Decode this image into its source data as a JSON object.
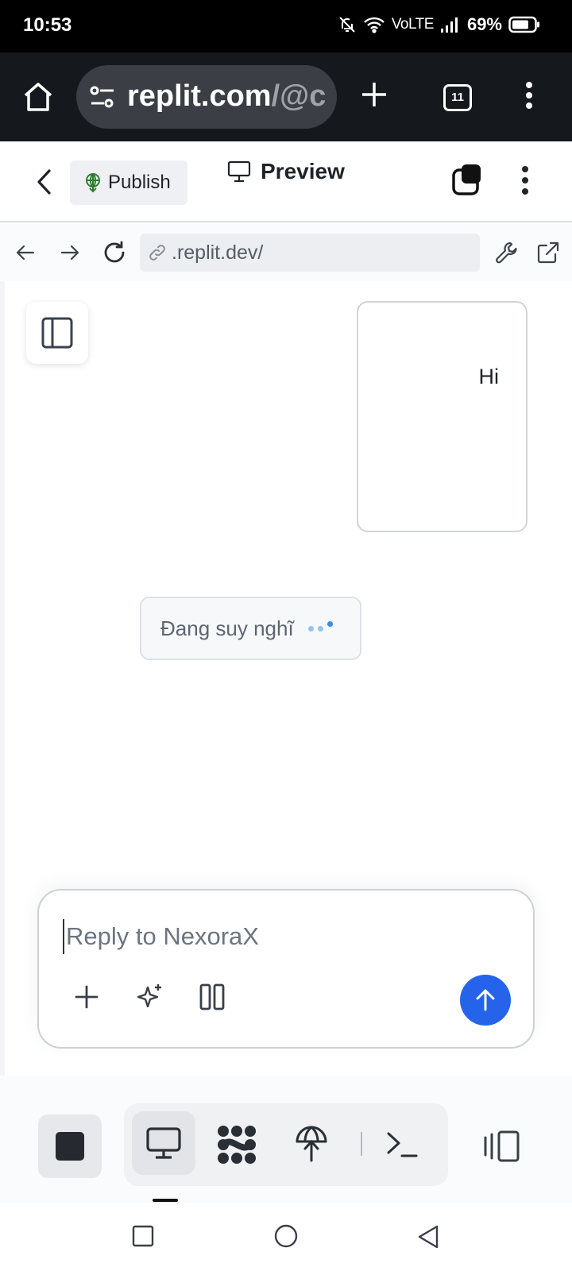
{
  "status_bar": {
    "time": "10:53",
    "network": "VoLTE",
    "battery": "69%"
  },
  "browser": {
    "url_main": "replit.com",
    "url_tail": "/@c",
    "tab_count": "11"
  },
  "topbar": {
    "publish_label": "Publish",
    "preview_label": "Preview"
  },
  "preview_nav": {
    "address": ".replit.dev/"
  },
  "chat": {
    "user_message": "Hi",
    "thinking_text": "Đang suy nghĩ"
  },
  "composer": {
    "placeholder": "Reply to NexoraX"
  },
  "colors": {
    "accent": "#2563eb",
    "browser_bar": "#15181c",
    "publish_icon": "#2e7d32"
  },
  "icons": {
    "browser": [
      "home-icon",
      "site-settings-icon",
      "new-tab-icon",
      "tabs-icon",
      "more-vert-icon"
    ],
    "topbar": [
      "back-chevron-icon",
      "publish-globe-icon",
      "monitor-icon",
      "layers-icon",
      "more-vert-icon"
    ],
    "preview_nav": [
      "arrow-left-icon",
      "arrow-right-icon",
      "reload-icon",
      "link-icon",
      "wrench-icon",
      "external-link-icon"
    ],
    "composer": [
      "plus-icon",
      "sparkle-icon",
      "columns-icon",
      "arrow-up-icon"
    ],
    "toolbar": [
      "stop-icon",
      "monitor-icon",
      "workflow-icon",
      "publish-icon",
      "terminal-icon",
      "split-view-icon"
    ]
  }
}
